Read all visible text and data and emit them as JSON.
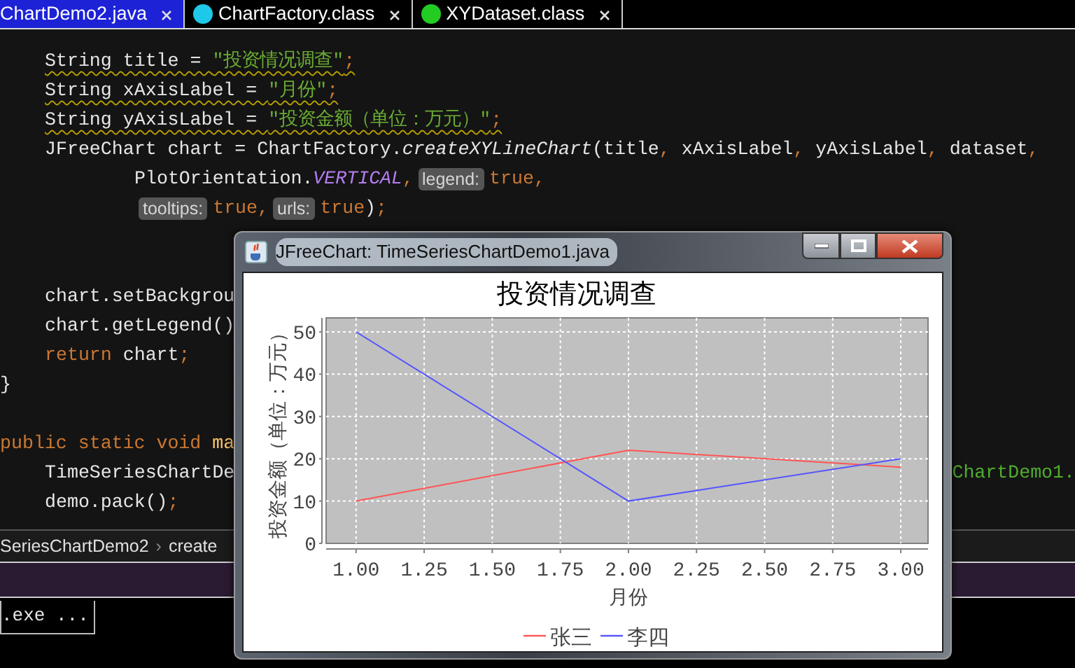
{
  "tabs": [
    {
      "label": "ChartDemo2.java",
      "selected": true,
      "kind": "java"
    },
    {
      "label": "ChartFactory.class",
      "selected": false,
      "kind": "class"
    },
    {
      "label": "XYDataset.class",
      "selected": false,
      "kind": "interface"
    }
  ],
  "code_lines": [
    {
      "kind": "statement",
      "warning": true,
      "tokens": [
        {
          "text": "String title = ",
          "kind": "plain"
        },
        {
          "text": "\"投资情况调查\"",
          "kind": "string"
        },
        {
          "text": ";",
          "kind": "punct"
        }
      ]
    },
    {
      "kind": "statement",
      "warning": true,
      "tokens": [
        {
          "text": "String xAxisLabel = ",
          "kind": "plain"
        },
        {
          "text": "\"月份\"",
          "kind": "string"
        },
        {
          "text": ";",
          "kind": "punct"
        }
      ]
    },
    {
      "kind": "statement",
      "warning": true,
      "tokens": [
        {
          "text": "String yAxisLabel = ",
          "kind": "plain"
        },
        {
          "text": "\"投资金额（单位：万元）\"",
          "kind": "string"
        },
        {
          "text": ";",
          "kind": "punct"
        }
      ]
    },
    {
      "kind": "statement",
      "warning": false,
      "tokens": [
        {
          "text": "JFreeChart chart = ChartFactory.",
          "kind": "plain"
        },
        {
          "text": "createXYLineChart",
          "kind": "static-call"
        },
        {
          "text": "(title",
          "kind": "plain"
        },
        {
          "text": ",",
          "kind": "punct"
        },
        {
          "text": " xAxisLabel",
          "kind": "plain"
        },
        {
          "text": ",",
          "kind": "punct"
        },
        {
          "text": " yAxisLabel",
          "kind": "plain"
        },
        {
          "text": ",",
          "kind": "punct"
        },
        {
          "text": " dataset",
          "kind": "plain"
        },
        {
          "text": ",",
          "kind": "punct"
        }
      ]
    },
    {
      "kind": "continuation",
      "warning": false,
      "tokens": [
        {
          "text": "PlotOrientation.",
          "kind": "plain"
        },
        {
          "text": "VERTICAL",
          "kind": "constant"
        },
        {
          "text": ",",
          "kind": "punct"
        },
        {
          "text": "legend:",
          "kind": "hint"
        },
        {
          "text": "true",
          "kind": "keyword"
        },
        {
          "text": ",",
          "kind": "punct"
        }
      ]
    },
    {
      "kind": "continuation",
      "warning": false,
      "tokens": [
        {
          "text": "tooltips:",
          "kind": "hint"
        },
        {
          "text": "true",
          "kind": "keyword"
        },
        {
          "text": ",",
          "kind": "punct"
        },
        {
          "text": "urls:",
          "kind": "hint"
        },
        {
          "text": "true",
          "kind": "keyword"
        },
        {
          "text": ")",
          "kind": "plain"
        },
        {
          "text": ";",
          "kind": "punct"
        }
      ]
    },
    {
      "kind": "blank"
    },
    {
      "kind": "blank"
    },
    {
      "kind": "statement",
      "warning": false,
      "tokens": [
        {
          "text": "chart.setBackgrou",
          "kind": "plain"
        }
      ]
    },
    {
      "kind": "statement",
      "warning": false,
      "tokens": [
        {
          "text": "chart.getLegend()",
          "kind": "plain"
        }
      ]
    },
    {
      "kind": "statement",
      "warning": false,
      "tokens": [
        {
          "text": "return",
          "kind": "keyword"
        },
        {
          "text": " chart",
          "kind": "plain"
        },
        {
          "text": ";",
          "kind": "punct"
        }
      ]
    },
    {
      "kind": "top",
      "warning": false,
      "tokens": [
        {
          "text": "}",
          "kind": "plain"
        }
      ]
    },
    {
      "kind": "blank"
    },
    {
      "kind": "top",
      "warning": false,
      "tokens": [
        {
          "text": "public static void",
          "kind": "keyword"
        },
        {
          "text": " ma",
          "kind": "method"
        }
      ]
    },
    {
      "kind": "statement",
      "warning": false,
      "tokens": [
        {
          "text": "TimeSeriesChartDe",
          "kind": "plain"
        },
        {
          "text": "ChartDemo1.",
          "kind": "string-right"
        }
      ]
    },
    {
      "kind": "statement",
      "warning": false,
      "tokens": [
        {
          "text": "demo.pack()",
          "kind": "plain"
        },
        {
          "text": ";",
          "kind": "punct"
        }
      ]
    }
  ],
  "breadcrumb": [
    "SeriesChartDemo2",
    "create"
  ],
  "breadcrumb_separator": "›",
  "run_tab": ".exe ...",
  "chart_window": {
    "title": "JFreeChart: TimeSeriesChartDemo1.java",
    "chart_data": {
      "type": "line",
      "title": "投资情况调查",
      "xlabel": "月份",
      "ylabel": "投资金额（单位：万元）",
      "x": [
        1,
        2,
        3
      ],
      "series": [
        {
          "name": "张三",
          "color": "#ff5555",
          "values": [
            10,
            22,
            18
          ]
        },
        {
          "name": "李四",
          "color": "#5555ff",
          "values": [
            50,
            10,
            20
          ]
        }
      ],
      "xlim": [
        0.89,
        3.1
      ],
      "ylim": [
        0,
        53.3
      ],
      "grid": true,
      "legend": "bottom",
      "xticks": [
        {
          "value": 1,
          "label": "1.00"
        },
        {
          "value": 1.25,
          "label": "1.25"
        },
        {
          "value": 1.5,
          "label": "1.50"
        },
        {
          "value": 1.75,
          "label": "1.75"
        },
        {
          "value": 2,
          "label": "2.00"
        },
        {
          "value": 2.25,
          "label": "2.25"
        },
        {
          "value": 2.5,
          "label": "2.50"
        },
        {
          "value": 2.75,
          "label": "2.75"
        },
        {
          "value": 3,
          "label": "3.00"
        }
      ],
      "yticks": [
        0,
        10,
        20,
        30,
        40,
        50
      ]
    }
  }
}
